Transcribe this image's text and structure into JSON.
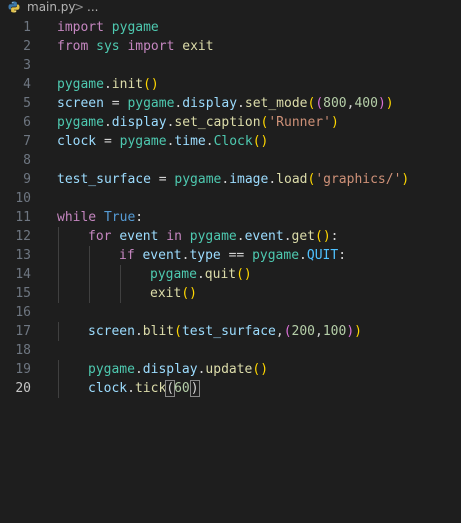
{
  "breadcrumb": {
    "file": "main.py",
    "separator": ">",
    "more": "..."
  },
  "editor": {
    "active_line": 20,
    "lines": [
      {
        "n": "1",
        "t": [
          [
            "kw",
            "import"
          ],
          [
            "op",
            " "
          ],
          [
            "cls",
            "pygame"
          ]
        ]
      },
      {
        "n": "2",
        "t": [
          [
            "kw",
            "from"
          ],
          [
            "op",
            " "
          ],
          [
            "cls",
            "sys"
          ],
          [
            "op",
            " "
          ],
          [
            "kw",
            "import"
          ],
          [
            "op",
            " "
          ],
          [
            "fn",
            "exit"
          ]
        ]
      },
      {
        "n": "3",
        "t": []
      },
      {
        "n": "4",
        "t": [
          [
            "cls",
            "pygame"
          ],
          [
            "op",
            "."
          ],
          [
            "fn",
            "init"
          ],
          [
            "p1",
            "()"
          ]
        ]
      },
      {
        "n": "5",
        "t": [
          [
            "var",
            "screen"
          ],
          [
            "op",
            " = "
          ],
          [
            "cls",
            "pygame"
          ],
          [
            "op",
            "."
          ],
          [
            "var",
            "display"
          ],
          [
            "op",
            "."
          ],
          [
            "fn",
            "set_mode"
          ],
          [
            "p1",
            "("
          ],
          [
            "p2",
            "("
          ],
          [
            "num",
            "800"
          ],
          [
            "op",
            ","
          ],
          [
            "num",
            "400"
          ],
          [
            "p2",
            ")"
          ],
          [
            "p1",
            ")"
          ]
        ]
      },
      {
        "n": "6",
        "t": [
          [
            "cls",
            "pygame"
          ],
          [
            "op",
            "."
          ],
          [
            "var",
            "display"
          ],
          [
            "op",
            "."
          ],
          [
            "fn",
            "set_caption"
          ],
          [
            "p1",
            "("
          ],
          [
            "str",
            "'Runner'"
          ],
          [
            "p1",
            ")"
          ]
        ]
      },
      {
        "n": "7",
        "t": [
          [
            "var",
            "clock"
          ],
          [
            "op",
            " = "
          ],
          [
            "cls",
            "pygame"
          ],
          [
            "op",
            "."
          ],
          [
            "var",
            "time"
          ],
          [
            "op",
            "."
          ],
          [
            "cls",
            "Clock"
          ],
          [
            "p1",
            "()"
          ]
        ]
      },
      {
        "n": "8",
        "t": []
      },
      {
        "n": "9",
        "t": [
          [
            "var",
            "test_surface"
          ],
          [
            "op",
            " = "
          ],
          [
            "cls",
            "pygame"
          ],
          [
            "op",
            "."
          ],
          [
            "var",
            "image"
          ],
          [
            "op",
            "."
          ],
          [
            "fn",
            "load"
          ],
          [
            "p1",
            "("
          ],
          [
            "str",
            "'graphics/'"
          ],
          [
            "p1",
            ")"
          ]
        ]
      },
      {
        "n": "10",
        "t": []
      },
      {
        "n": "11",
        "t": [
          [
            "kw",
            "while"
          ],
          [
            "op",
            " "
          ],
          [
            "kw2",
            "True"
          ],
          [
            "op",
            ":"
          ]
        ]
      },
      {
        "n": "12",
        "indent": 1,
        "t": [
          [
            "kw",
            "for"
          ],
          [
            "op",
            " "
          ],
          [
            "var",
            "event"
          ],
          [
            "op",
            " "
          ],
          [
            "kw",
            "in"
          ],
          [
            "op",
            " "
          ],
          [
            "cls",
            "pygame"
          ],
          [
            "op",
            "."
          ],
          [
            "var",
            "event"
          ],
          [
            "op",
            "."
          ],
          [
            "fn",
            "get"
          ],
          [
            "p1",
            "()"
          ],
          [
            "op",
            ":"
          ]
        ]
      },
      {
        "n": "13",
        "indent": 2,
        "t": [
          [
            "kw",
            "if"
          ],
          [
            "op",
            " "
          ],
          [
            "var",
            "event"
          ],
          [
            "op",
            "."
          ],
          [
            "var",
            "type"
          ],
          [
            "op",
            " == "
          ],
          [
            "cls",
            "pygame"
          ],
          [
            "op",
            "."
          ],
          [
            "const",
            "QUIT"
          ],
          [
            "op",
            ":"
          ]
        ]
      },
      {
        "n": "14",
        "indent": 3,
        "t": [
          [
            "cls",
            "pygame"
          ],
          [
            "op",
            "."
          ],
          [
            "fn",
            "quit"
          ],
          [
            "p1",
            "()"
          ]
        ]
      },
      {
        "n": "15",
        "indent": 3,
        "t": [
          [
            "fn",
            "exit"
          ],
          [
            "p1",
            "()"
          ]
        ]
      },
      {
        "n": "16",
        "t": []
      },
      {
        "n": "17",
        "indent": 1,
        "t": [
          [
            "var",
            "screen"
          ],
          [
            "op",
            "."
          ],
          [
            "fn",
            "blit"
          ],
          [
            "p1",
            "("
          ],
          [
            "var",
            "test_surface"
          ],
          [
            "op",
            ","
          ],
          [
            "p2",
            "("
          ],
          [
            "num",
            "200"
          ],
          [
            "op",
            ","
          ],
          [
            "num",
            "100"
          ],
          [
            "p2",
            ")"
          ],
          [
            "p1",
            ")"
          ]
        ]
      },
      {
        "n": "18",
        "t": []
      },
      {
        "n": "19",
        "indent": 1,
        "t": [
          [
            "cls",
            "pygame"
          ],
          [
            "op",
            "."
          ],
          [
            "var",
            "display"
          ],
          [
            "op",
            "."
          ],
          [
            "fn",
            "update"
          ],
          [
            "p1",
            "()"
          ]
        ]
      },
      {
        "n": "20",
        "indent": 1,
        "t": [
          [
            "var",
            "clock"
          ],
          [
            "op",
            "."
          ],
          [
            "fn",
            "tick"
          ],
          [
            "bm",
            "("
          ],
          [
            "num",
            "60"
          ],
          [
            "cursor",
            ""
          ],
          [
            "bm",
            ")"
          ]
        ]
      }
    ]
  }
}
